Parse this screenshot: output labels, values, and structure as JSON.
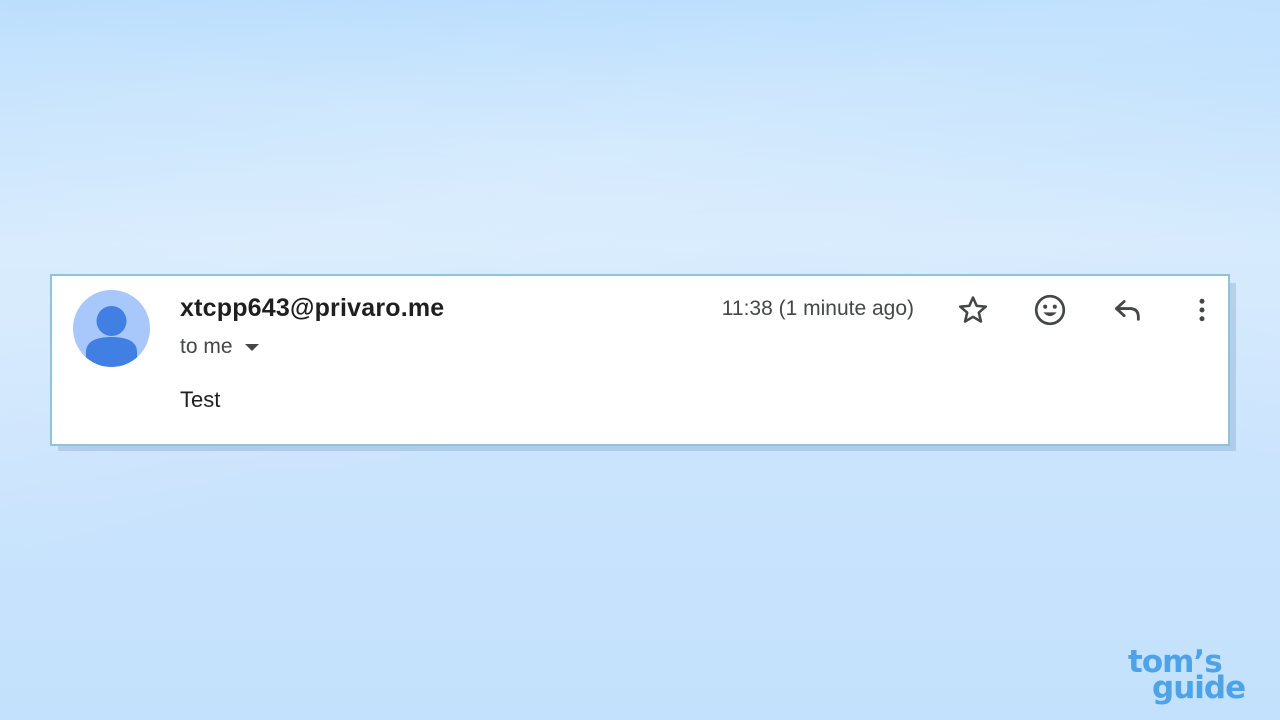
{
  "email": {
    "sender_address": "xtcpp643@privaro.me",
    "recipient_label": "to me",
    "timestamp": "11:38 (1 minute ago)",
    "body": "Test",
    "actions": {
      "star_icon": "star-outline-icon",
      "react_icon": "emoji-smile-icon",
      "reply_icon": "reply-arrow-icon",
      "more_icon": "more-vertical-icon"
    },
    "avatar_icon": "default-person-avatar-icon",
    "recipients_dropdown_icon": "caret-down-icon"
  },
  "watermark": {
    "line1": "tom's",
    "line2": "guide"
  },
  "colors": {
    "background_top": "#b6dcfd",
    "background_mid": "#d3e9fd",
    "card_border": "#8ec3db",
    "avatar_circle": "#a8c7fa",
    "avatar_person": "#4180e2",
    "watermark": "#4ea3e8",
    "text_primary": "#1f1f1f",
    "text_secondary": "#444746"
  }
}
